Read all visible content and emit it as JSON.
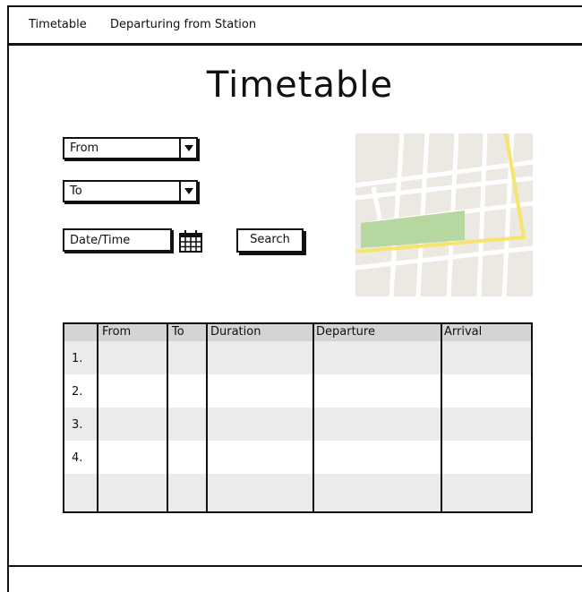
{
  "nav": {
    "title": "Timetable",
    "subtitle": "Departuring from Station"
  },
  "page": {
    "heading": "Timetable"
  },
  "form": {
    "from_label": "From",
    "to_label": "To",
    "datetime_label": "Date/Time",
    "search_label": "Search"
  },
  "table": {
    "columns": [
      "From",
      "To",
      "Duration",
      "Departure",
      "Arrival"
    ],
    "rows": [
      {
        "num": "1."
      },
      {
        "num": "2."
      },
      {
        "num": "3."
      },
      {
        "num": "4."
      },
      {
        "num": ""
      }
    ]
  },
  "colors": {
    "border": "#111111",
    "map_bg": "#ece9e2",
    "map_road_main": "#f7e46c",
    "map_park": "#b7d7a1"
  }
}
